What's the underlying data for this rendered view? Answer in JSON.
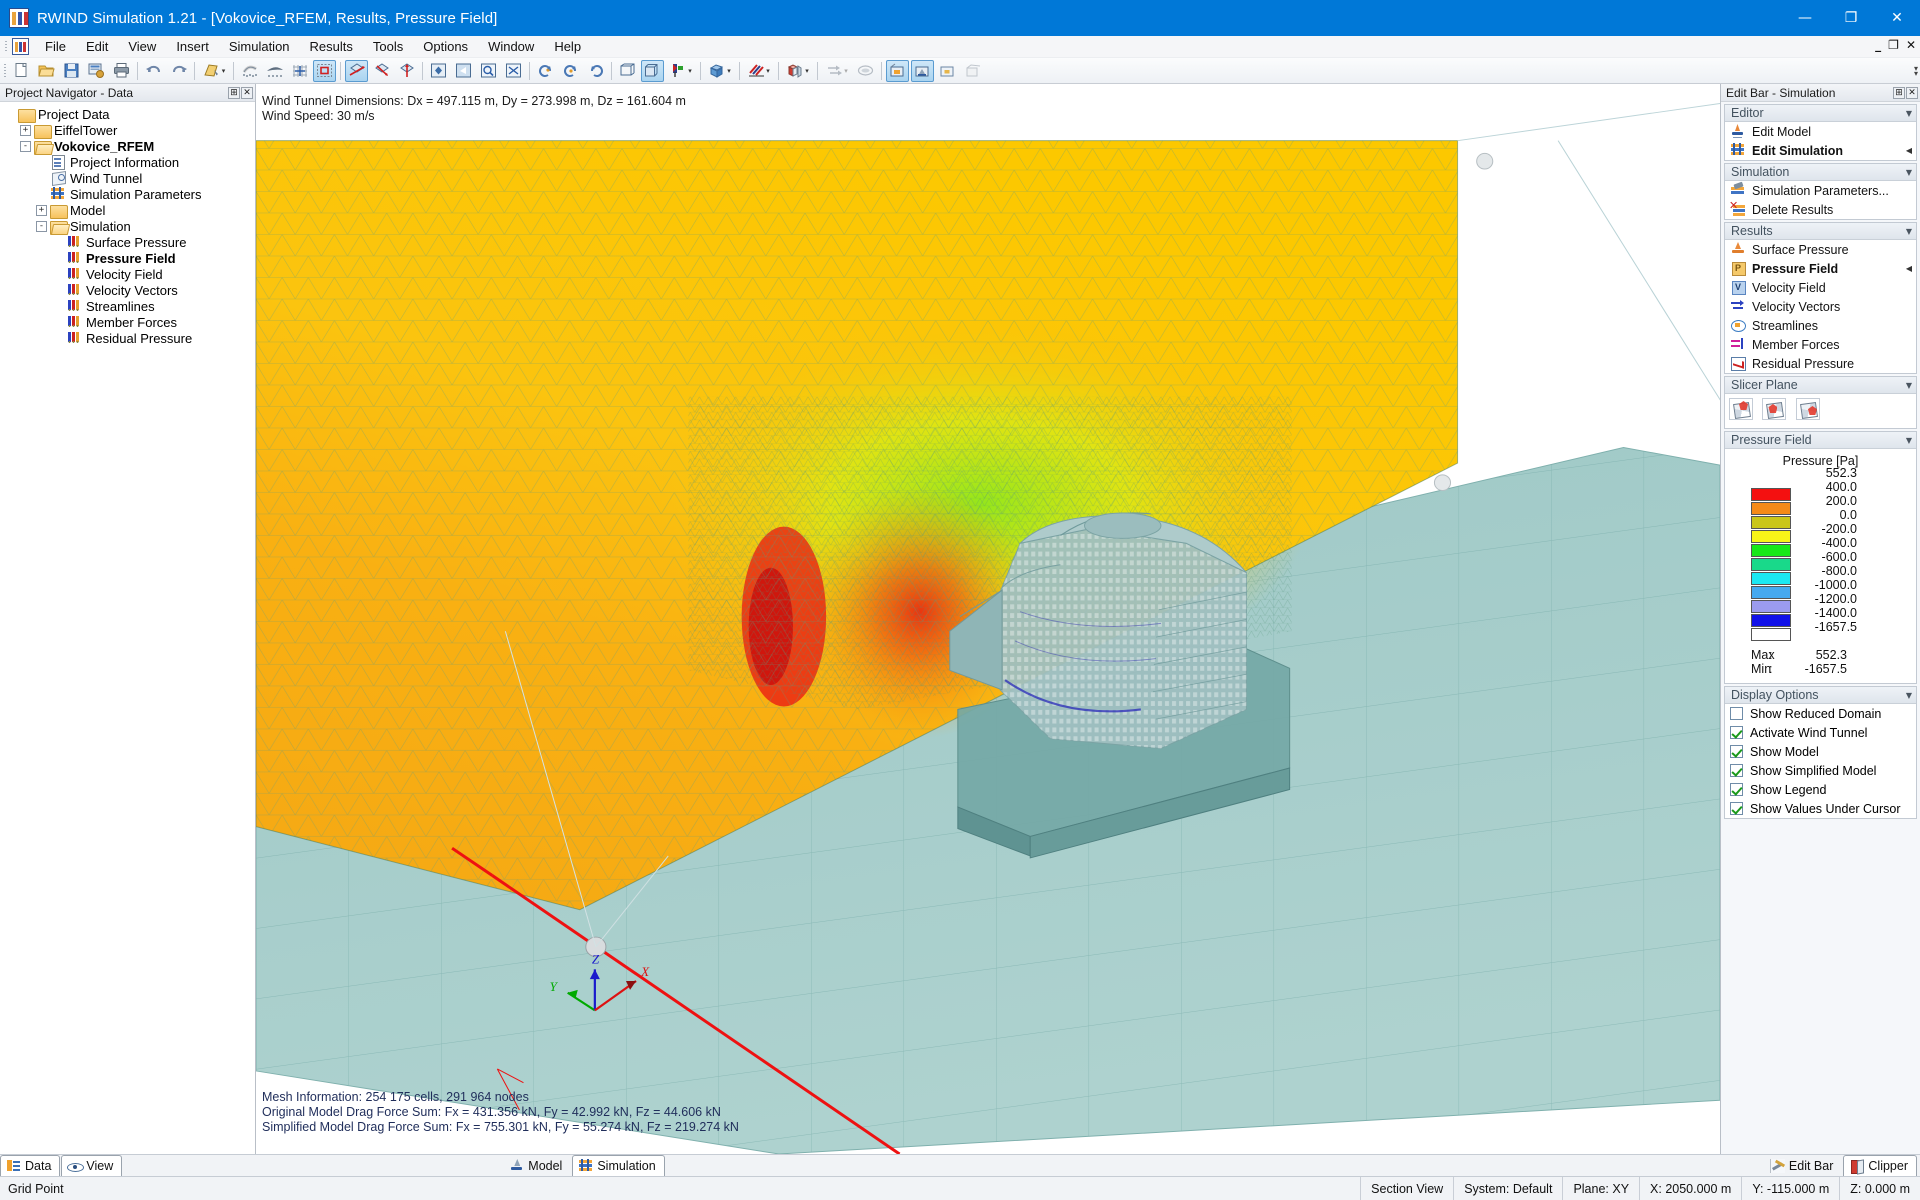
{
  "window": {
    "title": "RWIND Simulation 1.21 - [Vokovice_RFEM, Results, Pressure Field]",
    "minimize": "—",
    "maximize": "❐",
    "close": "✕",
    "inner_minimize": "_",
    "inner_restore": "❐",
    "inner_close": "✕"
  },
  "menu": {
    "items": [
      "File",
      "Edit",
      "View",
      "Insert",
      "Simulation",
      "Results",
      "Tools",
      "Options",
      "Window",
      "Help"
    ]
  },
  "toolbar": {
    "icons": [
      "new-document-icon",
      "open-folder-icon",
      "save-icon",
      "save-as-icon",
      "print-icon",
      "undo-icon",
      "redo-icon",
      "render-mode-icon",
      "point-cloud-icon",
      "eagle-view-icon",
      "snap-grid-icon",
      "selection-box-icon",
      "rotate-view-x-icon",
      "rotate-view-y-icon",
      "rotate-view-z-icon",
      "view-center-icon",
      "previous-view-icon",
      "zoom-window-icon",
      "zoom-all-icon",
      "rotate-left-icon",
      "rotate-ccw-icon",
      "rotate-cw-icon",
      "wireframe-icon",
      "solid-view-icon",
      "marker-icon",
      "render-box-icon",
      "section-icon",
      "clip-box-icon",
      "vector-flow-icon",
      "streamline-icon",
      "result-surface-icon",
      "result-model-icon",
      "result-grid-icon",
      "result-faded-icon"
    ]
  },
  "navigator": {
    "header_title": "Project Navigator - Data",
    "pin_label": "⊞",
    "close_label": "✕",
    "tree": [
      {
        "label": "Project Data",
        "depth": 0,
        "icon": "folder",
        "exp": "",
        "bold": false
      },
      {
        "label": "EiffelTower",
        "depth": 1,
        "icon": "folder",
        "exp": "+",
        "bold": false
      },
      {
        "label": "Vokovice_RFEM",
        "depth": 1,
        "icon": "folder-open",
        "exp": "-",
        "bold": true
      },
      {
        "label": "Project Information",
        "depth": 2,
        "icon": "doc",
        "exp": "",
        "bold": false
      },
      {
        "label": "Wind Tunnel",
        "depth": 2,
        "icon": "tunnel",
        "exp": "",
        "bold": false
      },
      {
        "label": "Simulation Parameters",
        "depth": 2,
        "icon": "params",
        "exp": "",
        "bold": false
      },
      {
        "label": "Model",
        "depth": 2,
        "icon": "folder",
        "exp": "+",
        "bold": false
      },
      {
        "label": "Simulation",
        "depth": 2,
        "icon": "folder-open",
        "exp": "-",
        "bold": false
      },
      {
        "label": "Surface Pressure",
        "depth": 3,
        "icon": "res",
        "exp": "",
        "bold": false
      },
      {
        "label": "Pressure Field",
        "depth": 3,
        "icon": "res",
        "exp": "",
        "bold": true
      },
      {
        "label": "Velocity Field",
        "depth": 3,
        "icon": "res",
        "exp": "",
        "bold": false
      },
      {
        "label": "Velocity Vectors",
        "depth": 3,
        "icon": "res",
        "exp": "",
        "bold": false
      },
      {
        "label": "Streamlines",
        "depth": 3,
        "icon": "res",
        "exp": "",
        "bold": false
      },
      {
        "label": "Member Forces",
        "depth": 3,
        "icon": "res",
        "exp": "",
        "bold": false
      },
      {
        "label": "Residual Pressure",
        "depth": 3,
        "icon": "res",
        "exp": "",
        "bold": false
      }
    ]
  },
  "viewport": {
    "overlay_top": [
      "Wind Tunnel Dimensions: Dx = 497.115 m, Dy = 273.998 m, Dz = 161.604 m",
      "Wind Speed: 30 m/s"
    ],
    "overlay_bottom": [
      "Mesh Information: 254 175 cells, 291 964 nodes",
      "Original Model Drag Force Sum: Fx = 431.356 kN, Fy = 42.992 kN, Fz = 44.606 kN",
      "Simplified Model Drag Force Sum: Fx = 755.301 kN, Fy = 55.274 kN, Fz = 219.274 kN"
    ],
    "axis_labels": {
      "x": "X",
      "y": "Y",
      "z": "Z"
    }
  },
  "editbar": {
    "header_title": "Edit Bar - Simulation",
    "pin_label": "⊞",
    "close_label": "✕",
    "groups": [
      {
        "title": "Editor",
        "items": [
          {
            "label": "Edit Model",
            "icon": "editmodel",
            "bold": false,
            "mark": ""
          },
          {
            "label": "Edit Simulation",
            "icon": "editsim",
            "bold": true,
            "mark": "◀"
          }
        ]
      },
      {
        "title": "Simulation",
        "items": [
          {
            "label": "Simulation Parameters...",
            "icon": "simparams",
            "bold": false,
            "mark": ""
          },
          {
            "label": "Delete Results",
            "icon": "delres",
            "bold": false,
            "mark": ""
          }
        ]
      },
      {
        "title": "Results",
        "items": [
          {
            "label": "Surface Pressure",
            "icon": "surfp",
            "bold": false,
            "mark": ""
          },
          {
            "label": "Pressure Field",
            "icon": "boxicon-P",
            "bold": true,
            "mark": "◀"
          },
          {
            "label": "Velocity Field",
            "icon": "boxicon-V",
            "bold": false,
            "mark": ""
          },
          {
            "label": "Velocity Vectors",
            "icon": "vvec",
            "bold": false,
            "mark": ""
          },
          {
            "label": "Streamlines",
            "icon": "stream",
            "bold": false,
            "mark": ""
          },
          {
            "label": "Member Forces",
            "icon": "memf",
            "bold": false,
            "mark": ""
          },
          {
            "label": "Residual Pressure",
            "icon": "residp",
            "bold": false,
            "mark": ""
          }
        ]
      }
    ],
    "slicer": {
      "title": "Slicer Plane",
      "buttons": [
        "slicer-plane-x-icon",
        "slicer-plane-y-icon",
        "slicer-plane-z-icon"
      ]
    },
    "pressure_field": {
      "title": "Pressure Field",
      "legend_title": "Pressure [Pa]",
      "max_label": "Max",
      "min_label": "Min",
      "colon": ":",
      "max_value": "552.3",
      "min_value": "-1657.5"
    },
    "display_options": {
      "title": "Display Options",
      "options": [
        {
          "label": "Show Reduced Domain",
          "checked": false
        },
        {
          "label": "Activate Wind Tunnel",
          "checked": true
        },
        {
          "label": "Show Model",
          "checked": true
        },
        {
          "label": "Show Simplified Model",
          "checked": true
        },
        {
          "label": "Show Legend",
          "checked": true
        },
        {
          "label": "Show Values Under Cursor",
          "checked": true
        }
      ]
    }
  },
  "chart_data": {
    "type": "heatmap",
    "title": "Pressure [Pa]",
    "legend_position": "right",
    "values": [
      552.3,
      400.0,
      200.0,
      0.0,
      -200.0,
      -400.0,
      -600.0,
      -800.0,
      -1000.0,
      -1200.0,
      -1400.0,
      -1657.5
    ],
    "colors": [
      "#a00a0a",
      "#f41010",
      "#f58a18",
      "#cac61a",
      "#f8f418",
      "#17e818",
      "#19d98a",
      "#1ce8f2",
      "#46a9ef",
      "#9b9bef",
      "#1010e8"
    ],
    "ylim": [
      -1657.5,
      552.3
    ],
    "ylabel": "Pressure [Pa]",
    "max": 552.3,
    "min": -1657.5,
    "unit": "Pa"
  },
  "bottom_tabs": {
    "left": [
      {
        "label": "Data",
        "icon": "data-icon",
        "selected": true
      },
      {
        "label": "View",
        "icon": "view-icon",
        "selected": false
      }
    ],
    "center": [
      {
        "label": "Model",
        "icon": "model-icon",
        "selected": false
      },
      {
        "label": "Simulation",
        "icon": "simulation-icon",
        "selected": true
      }
    ],
    "right": [
      {
        "label": "Edit Bar",
        "icon": "edit-bar-icon",
        "selected": false
      },
      {
        "label": "Clipper",
        "icon": "clipper-icon",
        "selected": true
      }
    ]
  },
  "statusbar": {
    "message": "Grid Point",
    "cells": [
      "Section View",
      "System: Default",
      "Plane: XY",
      "X:  2050.000 m",
      "Y:  -115.000 m",
      "Z:  0.000 m"
    ]
  }
}
